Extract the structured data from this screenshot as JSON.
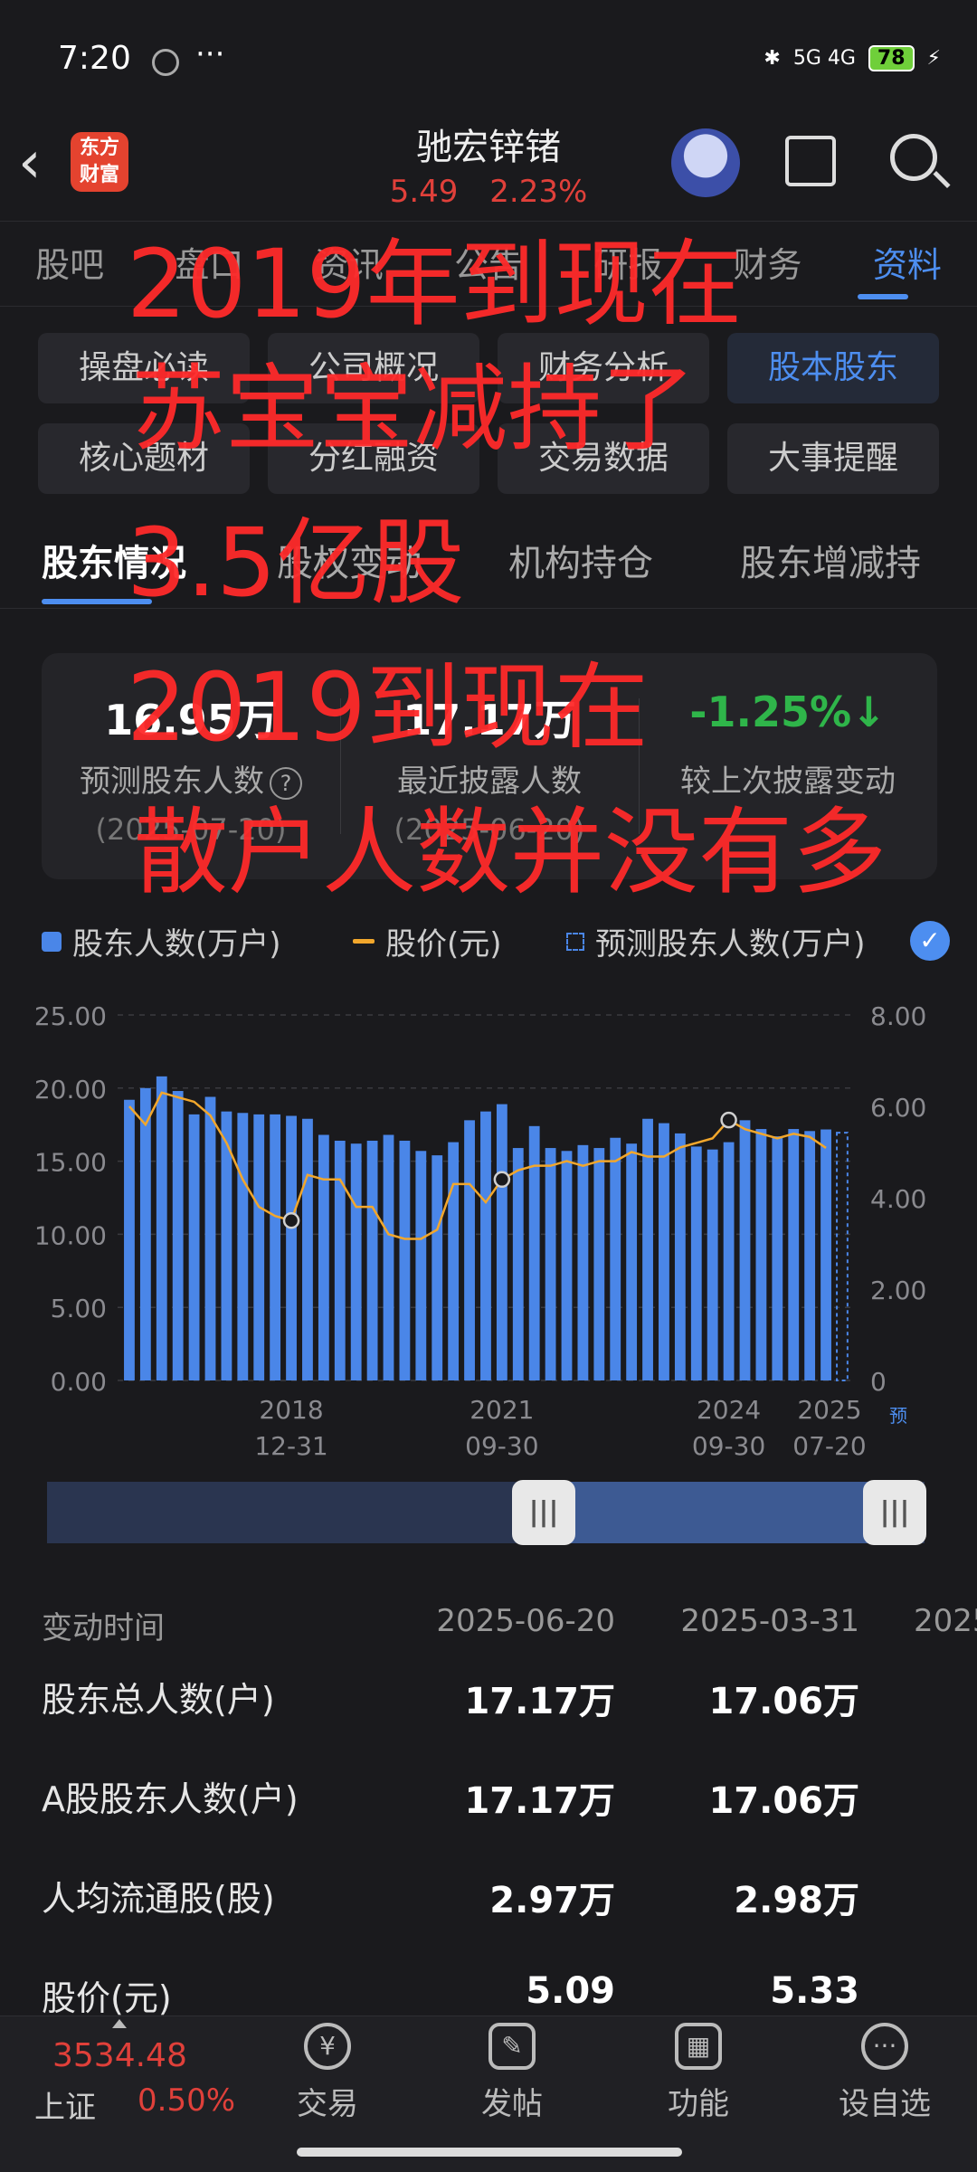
{
  "status_bar": {
    "time": "7:20",
    "more": "···",
    "network": "5G 4G",
    "battery": "78"
  },
  "header": {
    "logo_text": "东方财富",
    "stock_name": "驰宏锌锗",
    "price": "5.49",
    "change_pct": "2.23%"
  },
  "main_tabs": [
    "股吧",
    "盘口",
    "资讯",
    "公告",
    "研报",
    "财务",
    "资料"
  ],
  "main_tabs_active": 6,
  "sub_buttons": [
    "操盘必读",
    "公司概况",
    "财务分析",
    "股本股东",
    "核心题材",
    "分红融资",
    "交易数据",
    "大事提醒"
  ],
  "section_tabs": [
    "股东情况",
    "股权变动",
    "机构持仓",
    "股东增减持"
  ],
  "summary": {
    "predicted_value": "16.95万",
    "predicted_label": "预测股东人数",
    "predicted_help": "?",
    "predicted_date": "(2025-07-20)",
    "recent_value": "17.17万",
    "recent_label": "最近披露人数",
    "recent_date": "(2025-06-20)",
    "change_value": "-1.25%",
    "change_label": "较上次披露变动"
  },
  "legend": {
    "holders": "股东人数(万户)",
    "price": "股价(元)",
    "predicted": "预测股东人数(万户)"
  },
  "chart_data": {
    "type": "bar",
    "left_axis_ticks": [
      "25.00",
      "20.00",
      "15.00",
      "10.00",
      "5.00",
      "0.00"
    ],
    "right_axis_ticks": [
      "8.00",
      "6.00",
      "4.00",
      "2.00",
      "0"
    ],
    "ylim_left": [
      0,
      25
    ],
    "ylim_right": [
      0,
      8
    ],
    "x_tick_labels": [
      {
        "line1": "2018",
        "line2": "12-31"
      },
      {
        "line1": "2021",
        "line2": "09-30"
      },
      {
        "line1": "2024",
        "line2": "09-30"
      },
      {
        "line1": "2025",
        "line2": "07-20"
      }
    ],
    "predicted_tag": "预",
    "series": [
      {
        "name": "股东人数(万户)",
        "values": [
          19.2,
          20.0,
          20.8,
          19.8,
          18.2,
          19.4,
          18.4,
          18.3,
          18.2,
          18.2,
          18.1,
          17.9,
          16.8,
          16.4,
          16.2,
          16.4,
          16.8,
          16.4,
          15.7,
          15.4,
          16.3,
          17.8,
          18.4,
          18.9,
          15.9,
          17.4,
          15.9,
          15.7,
          16.1,
          15.9,
          16.6,
          16.2,
          17.9,
          17.6,
          16.9,
          16.0,
          15.8,
          16.3,
          17.8,
          17.2,
          16.7,
          17.2,
          17.06,
          17.17
        ]
      },
      {
        "name": "股价(元)",
        "values": [
          6.0,
          5.6,
          6.3,
          6.2,
          6.1,
          5.8,
          5.2,
          4.4,
          3.8,
          3.6,
          3.5,
          4.5,
          4.4,
          4.4,
          3.8,
          3.8,
          3.2,
          3.1,
          3.1,
          3.3,
          4.3,
          4.3,
          3.9,
          4.4,
          4.6,
          4.7,
          4.7,
          4.8,
          4.7,
          4.8,
          4.8,
          5.0,
          4.9,
          4.9,
          5.1,
          5.2,
          5.3,
          5.7,
          5.5,
          5.4,
          5.3,
          5.4,
          5.33,
          5.09
        ]
      },
      {
        "name": "预测股东人数(万户)",
        "values": [
          16.95
        ]
      }
    ]
  },
  "table": {
    "header": [
      "变动时间",
      "2025-06-20",
      "2025-03-31",
      "2025"
    ],
    "rows": [
      [
        "股东总人数(户)",
        "17.17万",
        "17.06万"
      ],
      [
        "A股股东人数(户)",
        "17.17万",
        "17.06万"
      ],
      [
        "人均流通股(股)",
        "2.97万",
        "2.98万"
      ],
      [
        "股价(元)",
        "5.09",
        "5.33"
      ]
    ]
  },
  "bottom_nav": {
    "index_value": "3534.48",
    "index_name": "上证",
    "index_pct": "0.50%",
    "items": [
      "交易",
      "发帖",
      "功能",
      "设自选"
    ]
  },
  "annotation": [
    "2019年到现在",
    "苏宝宝减持了",
    "3.5亿股",
    "2019到现在",
    "散户人数并没有多"
  ],
  "colors": {
    "accent": "#4d8ef0",
    "up": "#e0403a",
    "down": "#2fb54a",
    "bars": "#4a86e8",
    "price_line": "#f2a72c",
    "annotation": "#ff2a2a"
  }
}
